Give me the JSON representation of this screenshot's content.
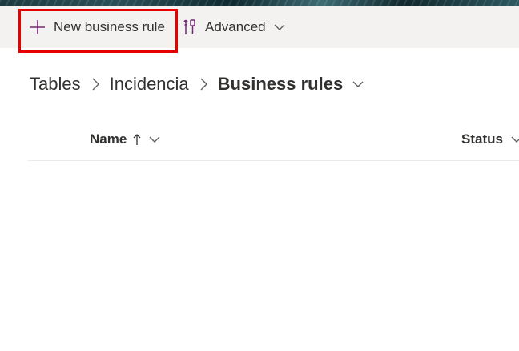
{
  "commandbar": {
    "new_rule_label": "New business rule",
    "advanced_label": "Advanced"
  },
  "breadcrumb": {
    "items": [
      "Tables",
      "Incidencia",
      "Business rules"
    ]
  },
  "grid": {
    "columns": [
      "Name",
      "Status"
    ],
    "sort": "ascending"
  },
  "colors": {
    "accent": "#742774",
    "highlight": "#e60000",
    "commandbar_bg": "#f3f2f1"
  },
  "icons": {
    "new": "plus-icon",
    "advanced": "tools-icon",
    "dropdown": "chevron-down-icon",
    "separator": "chevron-right-icon",
    "sort": "arrow-up-icon"
  }
}
